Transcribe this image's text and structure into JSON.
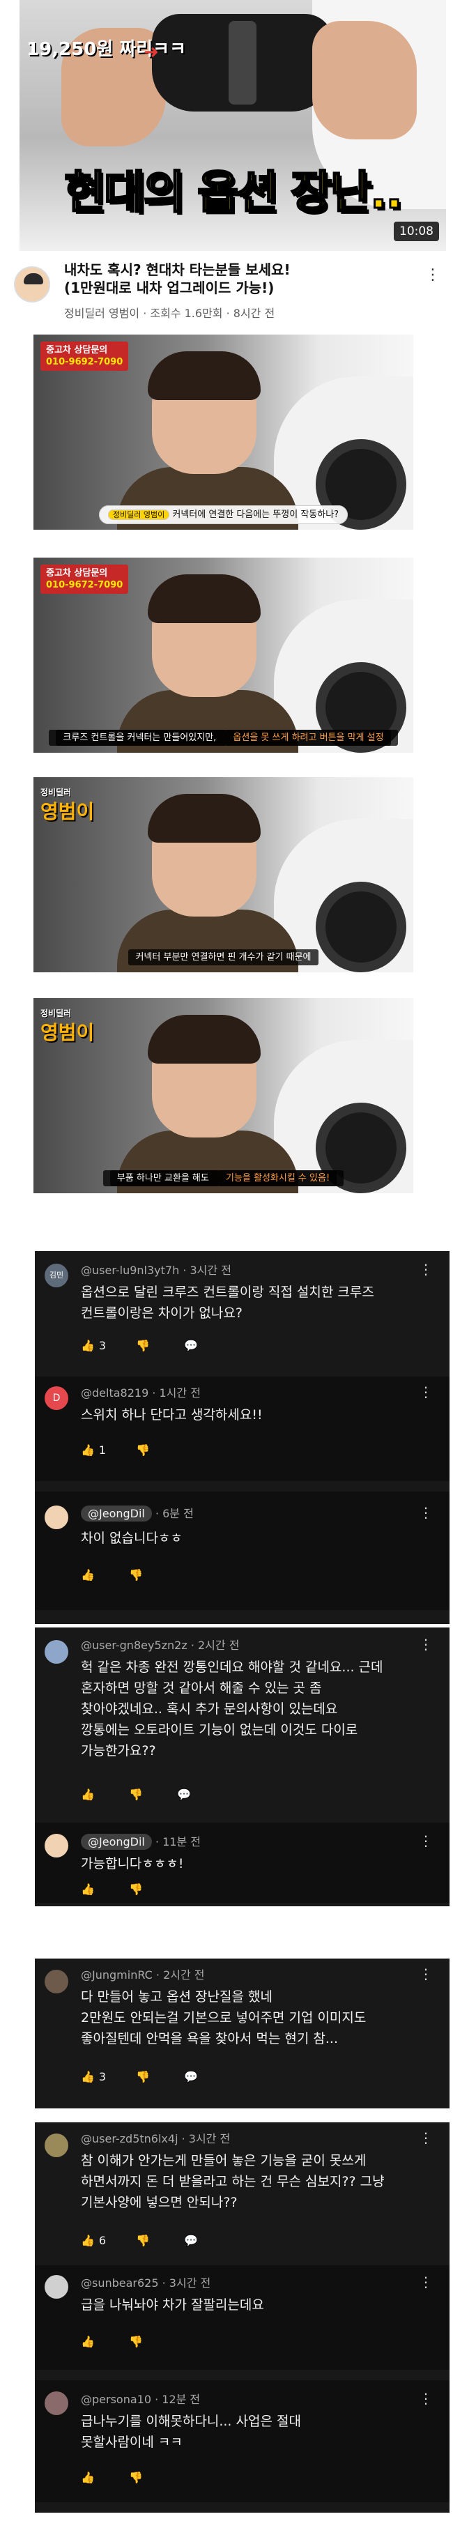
{
  "video": {
    "price_label": "19,250원 짜리ㅋㅋ",
    "title_part1": "현대의 ",
    "title_part2": "옵션 장난..",
    "duration": "10:08",
    "title": "내차도 혹시? 현대차 타는분들 보세요!\n(1만원대로 내차 업그레이드 가능!)",
    "meta": "정비딜러 영범이 · 조회수 1.6만회 · 8시간 전"
  },
  "frames": [
    {
      "badge_top": "중고차 상담문의",
      "badge_phone": "010-9692-7090",
      "sub_name": "정비딜러 영범이",
      "sub_text": "커넥터에 연결한 다음에는 뚜껑이 작동하나?"
    },
    {
      "badge_top": "중고차 상담문의",
      "badge_phone": "010-9672-7090",
      "sub_text": "크루즈 컨트롤을 커넥터는 만들어있지만, ",
      "sub_warn": "옵션을 못 쓰게 하려고 버튼을 막게 설정"
    },
    {
      "logo_small": "정비딜러",
      "logo_big": "영범이",
      "sub_text": "커넥터 부분만 연결하면 핀 개수가 같기 때문에"
    },
    {
      "logo_small": "정비딜러",
      "logo_big": "영범이",
      "sub_text": "부품 하나만 교환을 해도 ",
      "sub_warn": "기능을 활성화시킬 수 있음!"
    }
  ],
  "comments": [
    {
      "avatar": "김민",
      "handle": "@user-lu9nl3yt7h · 3시간 전",
      "text": "옵션으로 달린 크루즈 컨트롤이랑 직접 설치한 크루즈\n컨트롤이랑은 차이가 없나요?",
      "likes": "3"
    },
    {
      "avatar": "D",
      "handle": "@delta8219 · 1시간 전",
      "text": "스위치 하나 단다고 생각하세요!!",
      "likes": "1"
    },
    {
      "handle_tag": "@JeongDil",
      "handle_time": " · 6분 전",
      "text": "차이 없습니다ㅎㅎ",
      "likes": ""
    },
    {
      "handle": "@user-gn8ey5zn2z · 2시간 전",
      "text": "헉 같은 차종 완전 깡통인데요 해야할 것 같네요... 근데\n혼자하면 망할 것 같아서 해줄 수 있는 곳 좀\n찾아야겠네요.. 혹시 추가 문의사항이 있는데요\n깡통에는 오토라이트 기능이 없는데 이것도 다이로\n가능한가요??",
      "likes": ""
    },
    {
      "handle_tag": "@JeongDil",
      "handle_time": " · 11분 전",
      "text": "가능합니다ㅎㅎㅎ!",
      "likes": ""
    },
    {
      "handle": "@JungminRC · 2시간 전",
      "text": "다 만들어 놓고 옵션 장난질을 했네\n2만원도 안되는걸 기본으로 넣어주면 기업 이미지도\n좋아질텐데 안먹을 욕을 찾아서 먹는 현기 참...",
      "likes": "3"
    },
    {
      "handle": "@user-zd5tn6lx4j · 3시간 전",
      "text": "참 이해가 안가는게 만들어 놓은 기능을 굳이 못쓰게\n하면서까지 돈 더 받을라고 하는 건 무슨 심보지?? 그냥\n기본사양에 넣으면 안되나??",
      "likes": "6"
    },
    {
      "handle": "@sunbear625 · 3시간 전",
      "text": "급을 나눠놔야 차가 잘팔리는데요",
      "likes": ""
    },
    {
      "handle": "@persona10 · 12분 전",
      "text": "급나누기를 이해못하다니... 사업은 절대\n못할사람이네 ㅋㅋ",
      "likes": ""
    }
  ]
}
